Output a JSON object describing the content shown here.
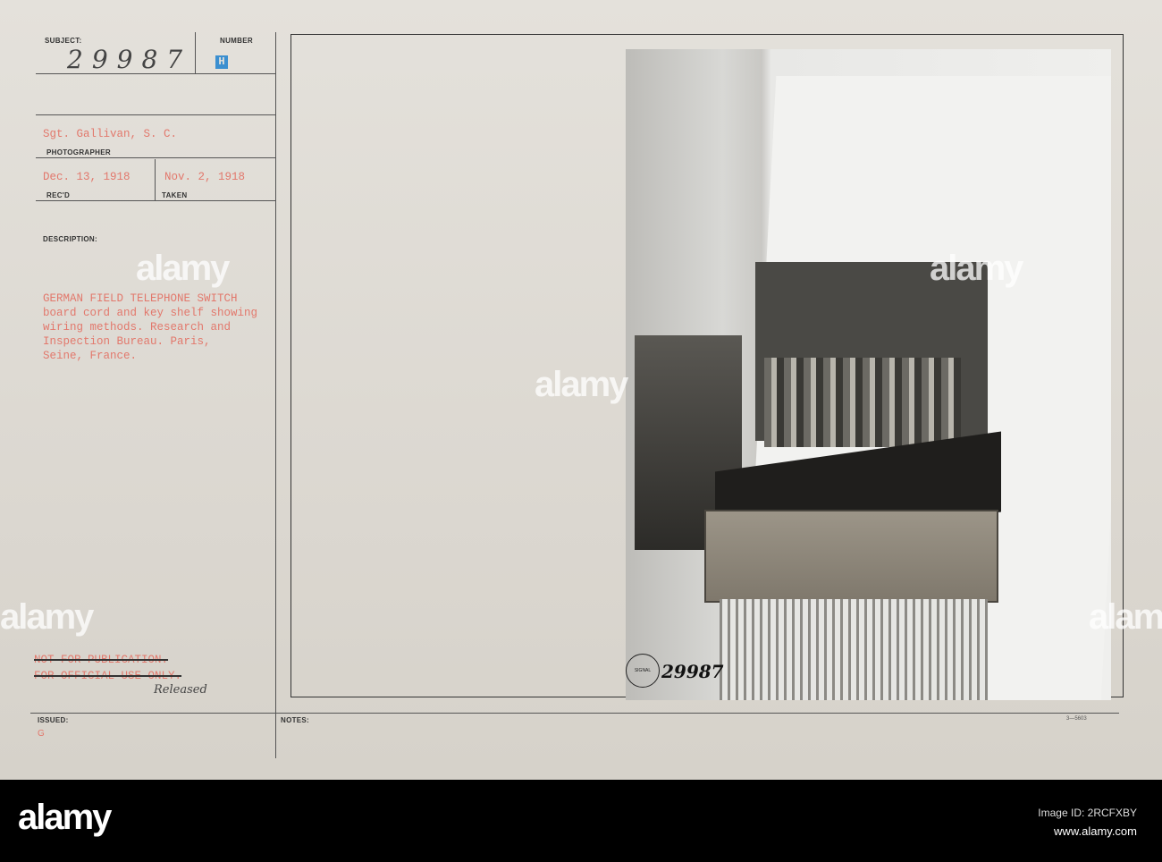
{
  "card": {
    "subject_label": "SUBJECT:",
    "subject_value": "29987",
    "number_label": "NUMBER",
    "number_stamp": "H",
    "photographer": "Sgt. Gallivan, S. C.",
    "photographer_label": "PHOTOGRAPHER",
    "received": "Dec. 13, 1918",
    "received_label": "REC'D",
    "taken": "Nov. 2, 1918",
    "taken_label": "TAKEN",
    "description_label": "DESCRIPTION:",
    "description_lines": [
      "GERMAN FIELD TELEPHONE SWITCH",
      "board cord and key shelf showing",
      "wiring methods. Research and",
      "Inspection Bureau. Paris,",
      "Seine, France."
    ],
    "restriction_lines": [
      "NOT FOR PUBLICATION.",
      "FOR OFFICIAL USE ONLY."
    ],
    "released": "Released",
    "issued_label": "ISSUED:",
    "issued_value": "G",
    "notes_label": "NOTES:",
    "form_number": "3—5603"
  },
  "photo": {
    "stamp_text": "SIGNAL CORPS USA",
    "photo_number": "29987"
  },
  "watermark": {
    "brand": "alamy",
    "image_id": "Image ID: 2RCFXBY",
    "url": "www.alamy.com"
  },
  "colors": {
    "typed_red": "#e2786c",
    "stamp_blue": "#3b8fd0"
  }
}
